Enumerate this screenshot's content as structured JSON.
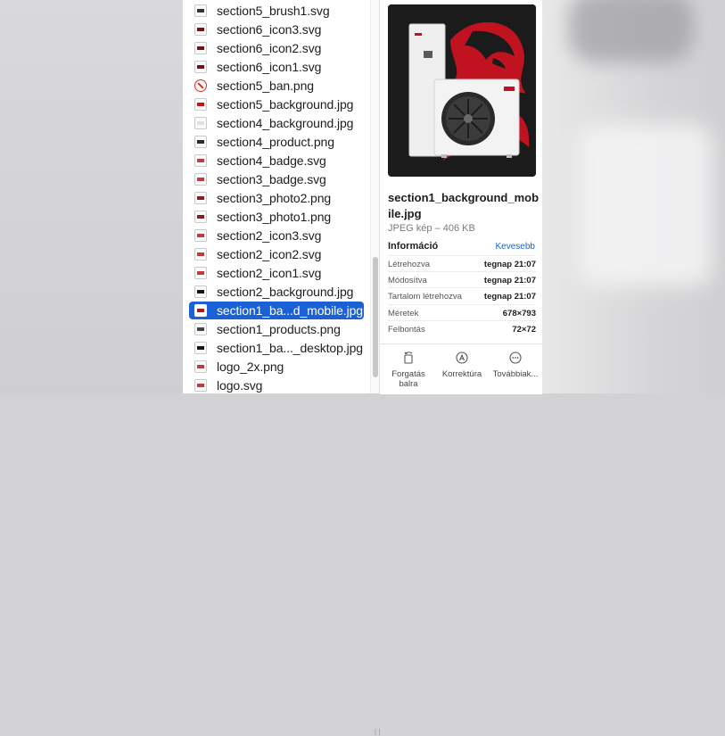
{
  "files": [
    {
      "name": "section5_brush1.svg",
      "icon": "svg-file-icon",
      "icon_color": "#333333",
      "selected": false
    },
    {
      "name": "section6_icon3.svg",
      "icon": "svg-file-icon",
      "icon_color": "#7a1010",
      "selected": false
    },
    {
      "name": "section6_icon2.svg",
      "icon": "svg-file-icon",
      "icon_color": "#7a1010",
      "selected": false
    },
    {
      "name": "section6_icon1.svg",
      "icon": "svg-file-icon",
      "icon_color": "#7a1010",
      "selected": false
    },
    {
      "name": "section5_ban.png",
      "icon": "ban-image-icon",
      "icon_color": "#d93025",
      "selected": false
    },
    {
      "name": "section5_background.jpg",
      "icon": "image-file-icon",
      "icon_color": "#d01010",
      "selected": false
    },
    {
      "name": "section4_background.jpg",
      "icon": "image-file-icon",
      "icon_color": "#e0e0e0",
      "selected": false
    },
    {
      "name": "section4_product.png",
      "icon": "image-file-icon",
      "icon_color": "#2b2b2b",
      "selected": false
    },
    {
      "name": "section4_badge.svg",
      "icon": "svg-file-icon",
      "icon_color": "#c23b3b",
      "selected": false
    },
    {
      "name": "section3_badge.svg",
      "icon": "svg-file-icon",
      "icon_color": "#c23b3b",
      "selected": false
    },
    {
      "name": "section3_photo2.png",
      "icon": "image-file-icon",
      "icon_color": "#8a1c1c",
      "selected": false
    },
    {
      "name": "section3_photo1.png",
      "icon": "image-file-icon",
      "icon_color": "#8a1c1c",
      "selected": false
    },
    {
      "name": "section2_icon3.svg",
      "icon": "svg-file-icon",
      "icon_color": "#c23b3b",
      "selected": false
    },
    {
      "name": "section2_icon2.svg",
      "icon": "svg-file-icon",
      "icon_color": "#c23b3b",
      "selected": false
    },
    {
      "name": "section2_icon1.svg",
      "icon": "svg-file-icon",
      "icon_color": "#c23b3b",
      "selected": false
    },
    {
      "name": "section2_background.jpg",
      "icon": "image-file-icon",
      "icon_color": "#151515",
      "selected": false
    },
    {
      "name": "section1_ba...d_mobile.jpg",
      "icon": "image-file-icon",
      "icon_color": "#b01818",
      "selected": true
    },
    {
      "name": "section1_products.png",
      "icon": "image-file-icon",
      "icon_color": "#444444",
      "selected": false
    },
    {
      "name": "section1_ba..._desktop.jpg",
      "icon": "image-file-icon",
      "icon_color": "#151515",
      "selected": false
    },
    {
      "name": "logo_2x.png",
      "icon": "image-file-icon",
      "icon_color": "#c23b3b",
      "selected": false
    },
    {
      "name": "logo.svg",
      "icon": "svg-file-icon",
      "icon_color": "#c23b3b",
      "selected": false
    }
  ],
  "inspector": {
    "title": "section1_background_mobile.jpg",
    "subtitle": "JPEG kép – 406 KB",
    "info_heading": "Információ",
    "info_toggle": "Kevesebb",
    "rows": [
      {
        "label": "Létrehozva",
        "value": "tegnap 21:07"
      },
      {
        "label": "Módosítva",
        "value": "tegnap 21:07"
      },
      {
        "label": "Tartalom létrehozva",
        "value": "tegnap 21:07"
      },
      {
        "label": "Méretek",
        "value": "678×793"
      },
      {
        "label": "Felbontás",
        "value": "72×72"
      }
    ]
  },
  "toolbar": {
    "rotate_label": "Forgatás balra",
    "markup_label": "Korrektúra",
    "more_label": "Továbbiak..."
  },
  "colors": {
    "selection": "#1a61d6",
    "link": "#1a61d6",
    "preview_background": "#1b1b1b",
    "preview_accent": "#c1121f"
  }
}
